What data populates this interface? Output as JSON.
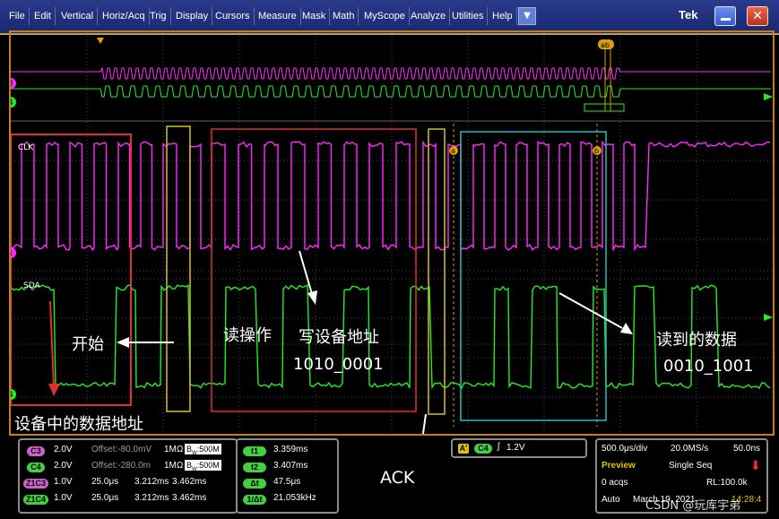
{
  "menu": {
    "items": [
      "File",
      "Edit",
      "Vertical",
      "Horiz/Acq",
      "Trig",
      "Display",
      "Cursors",
      "Measure",
      "Mask",
      "Math",
      "MyScope",
      "Analyze",
      "Utilities",
      "Help"
    ],
    "dropdown_icon": "chevron-down-icon",
    "brand": "Tek",
    "minimize_icon": "minimize-icon",
    "close_icon": "close-icon"
  },
  "channels": {
    "clk_label": "CLK",
    "sda_label": "SDA",
    "markers": [
      "3",
      "4",
      "1",
      "4"
    ],
    "cursor_a": "a",
    "cursor_b": "b",
    "cursor_ab": "ab"
  },
  "annotations": {
    "start": "开始",
    "device_addr": "设备中的数据地址",
    "read_op": "读操作",
    "write_addr": "写设备地址",
    "write_bits": "1010_0001",
    "read_data": "读到的数据",
    "read_bits": "0010_1001",
    "ack": "ACK"
  },
  "colors": {
    "ch3": "#ff2aff",
    "ch4": "#22ee22",
    "grid": "#4a4a4a",
    "red_box": "#e03030",
    "yellow_box": "#d8c020",
    "cyan_box": "#20c0c0",
    "cursor": "#d8a000"
  },
  "vertical_panel": {
    "rows": [
      {
        "tag": "C3",
        "scale": "2.0V",
        "offset": "Offset:-80.0mV",
        "imp": "1MΩ",
        "bw": "500M",
        "color": "#d060d0"
      },
      {
        "tag": "C4",
        "scale": "2.0V",
        "offset": "Offset:-280.0m",
        "imp": "1MΩ",
        "bw": "500M",
        "color": "#40d040"
      },
      {
        "tag": "Z1C3",
        "scale": "1.0V",
        "t1": "25.0μs",
        "t2": "3.212ms",
        "t3": "3.462ms",
        "color": "#d060d0"
      },
      {
        "tag": "Z1C4",
        "scale": "1.0V",
        "t1": "25.0μs",
        "t2": "3.212ms",
        "t3": "3.462ms",
        "color": "#40d040"
      }
    ]
  },
  "cursor_panel": {
    "rows": [
      {
        "tag": "t1",
        "value": "3.359ms"
      },
      {
        "tag": "t2",
        "value": "3.407ms"
      },
      {
        "tag": "Δt",
        "value": "47.5μs"
      },
      {
        "tag": "1/Δt",
        "value": "21.053kHz"
      }
    ]
  },
  "trigger_panel": {
    "source": "A'",
    "channel": "C4",
    "level": "1.2V",
    "slope_icon": "rising-edge-icon"
  },
  "acq_panel": {
    "timebase": "500.0μs/div",
    "rate": "20.0MS/s",
    "resolution": "50.0ns",
    "mode": "Preview",
    "seq": "Single Seq",
    "acqs": "0 acqs",
    "rl": "RL:100.0k",
    "auto": "Auto",
    "date": "March 19, 2021",
    "time": "14:28:4",
    "stop_icon": "stop-arrow-icon"
  },
  "watermark": "CSDN @玩库宇弟"
}
